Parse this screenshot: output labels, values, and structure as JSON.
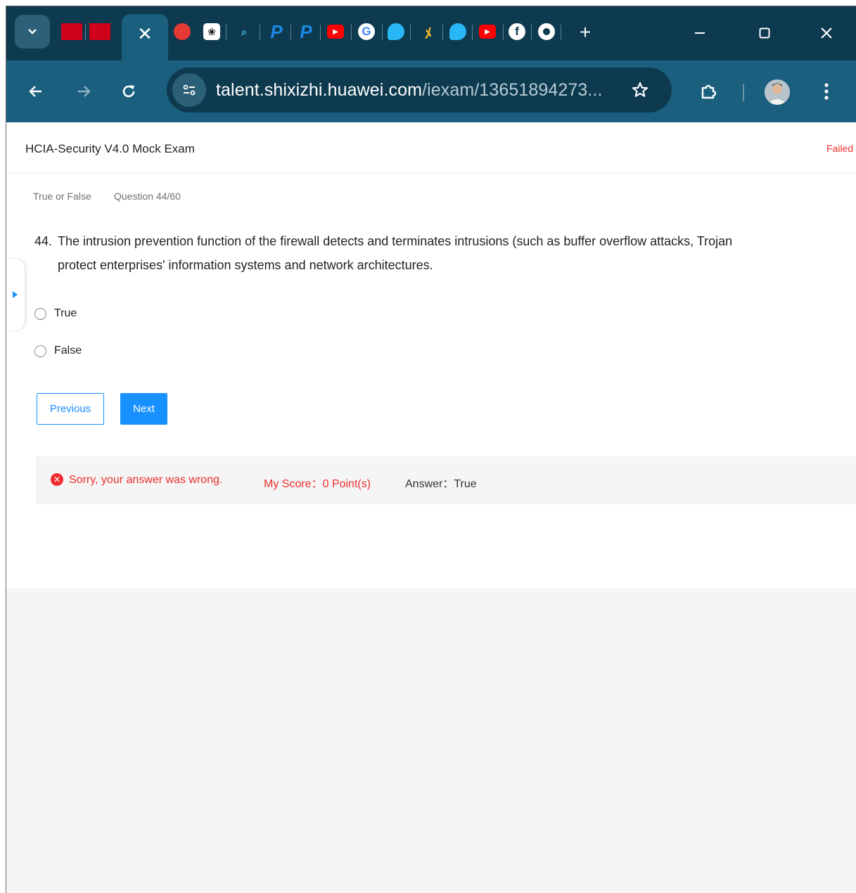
{
  "browser": {
    "tabs": [
      {
        "icon": "huawei-icon",
        "color": "#d0021b"
      },
      {
        "icon": "huawei-icon",
        "color": "#d0021b"
      },
      {
        "icon": "close-tab-icon",
        "active": true
      },
      {
        "icon": "robot-icon",
        "color": "#e53935"
      },
      {
        "icon": "openai-icon",
        "color": "#ffffff"
      },
      {
        "icon": "search-icon",
        "color": "#4fc3f7"
      },
      {
        "icon": "paypal-icon",
        "color": "#1e88e5"
      },
      {
        "icon": "paypal-icon",
        "color": "#1e88e5"
      },
      {
        "icon": "youtube-icon",
        "color": "#ff0000"
      },
      {
        "icon": "google-icon",
        "color": "#ffffff"
      },
      {
        "icon": "bird-icon",
        "color": "#29b6f6"
      },
      {
        "icon": "giraffe-icon",
        "color": "#fbc02d"
      },
      {
        "icon": "bird-icon",
        "color": "#29b6f6"
      },
      {
        "icon": "youtube-icon",
        "color": "#ff0000"
      },
      {
        "icon": "facebook-icon",
        "color": "#ffffff"
      },
      {
        "icon": "chrome-icon",
        "color": "#ffffff"
      }
    ],
    "url_domain": "talent.shixizhi.huawei.com",
    "url_path": "/iexam/13651894273..."
  },
  "exam": {
    "title": "HCIA-Security V4.0 Mock Exam",
    "status": "Failed",
    "question_type": "True or False",
    "question_progress": "Question 44/60",
    "question_number": "44.",
    "question_line1": "The intrusion prevention function of the firewall detects and terminates intrusions (such as buffer overflow attacks, Trojan",
    "question_line2": "protect enterprises' information systems and network architectures.",
    "options": [
      "True",
      "False"
    ],
    "previous_label": "Previous",
    "next_label": "Next",
    "result_message": "Sorry, your answer was wrong.",
    "score_text": "My Score：0 Point(s)",
    "answer_text": "Answer：True"
  },
  "colors": {
    "primary": "#1890ff",
    "error": "#ee2e2e",
    "browser_dark": "#0d3a4e",
    "browser_toolbar": "#1b5f7e"
  }
}
